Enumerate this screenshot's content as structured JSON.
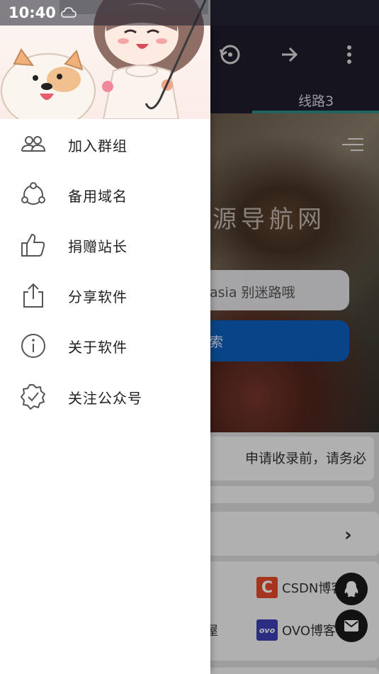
{
  "status_bar": {
    "time": "10:40",
    "notification_icon": "cloud-icon"
  },
  "toolbar": {
    "icons": [
      "history-icon",
      "forward-icon",
      "more-vert-icon"
    ],
    "active_tab": "线路3"
  },
  "hero": {
    "watermark": "源导航网",
    "search_text": "asia 别迷路哦",
    "search_button": "索"
  },
  "content": {
    "notice": "申请收录前，请务必",
    "links": [
      {
        "label": "CSDN博客",
        "badge": "C",
        "color": "#e8482c"
      },
      {
        "label": "OVO博客",
        "badge": "ovo",
        "color": "#3b3fb4"
      }
    ],
    "partial_text": "屋"
  },
  "drawer": {
    "items": [
      {
        "label": "加入群组",
        "icon": "group-icon"
      },
      {
        "label": "备用域名",
        "icon": "share-nodes-icon"
      },
      {
        "label": "捐赠站长",
        "icon": "thumbs-up-icon"
      },
      {
        "label": "分享软件",
        "icon": "upload-share-icon"
      },
      {
        "label": "关于软件",
        "icon": "info-icon"
      },
      {
        "label": "关注公众号",
        "icon": "verified-badge-icon"
      }
    ]
  },
  "colors": {
    "accent": "#2f8d84",
    "primary_button": "#0f5fbd",
    "toolbar": "#1e1d2b"
  }
}
